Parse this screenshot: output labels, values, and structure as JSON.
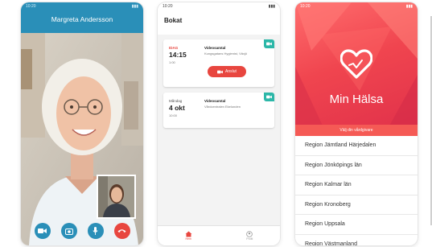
{
  "call": {
    "status_time": "10:20",
    "caller_name": "Margreta Andersson",
    "controls": [
      "camera-icon",
      "switch-camera-icon",
      "microphone-icon",
      "hang-up-icon"
    ]
  },
  "bookings": {
    "status_time": "10:20",
    "title": "Bokat",
    "cards": [
      {
        "day": "IDAG",
        "time": "14:15",
        "duration": "1:00",
        "type": "Videosamtal",
        "place": "Kungsgatans Hygienist, Växjö",
        "join_label": "Anslut"
      },
      {
        "day": "Måndag",
        "time": "4 okt",
        "duration": "10:00",
        "type": "Videosamtal",
        "place": "Vårdcentralen Ekelunden"
      }
    ],
    "nav": [
      {
        "label": "Hem",
        "icon": "home-icon"
      },
      {
        "label": "Profil",
        "icon": "profile-icon"
      }
    ]
  },
  "regions": {
    "status_time": "10:20",
    "app_title": "Min Hälsa",
    "subtitle": "Välj din vårdgivare",
    "items": [
      "Region Jämtland Härjedalen",
      "Region Jönköpings län",
      "Region Kalmar län",
      "Region Kronoberg",
      "Region Uppsala",
      "Region Västmanland"
    ]
  },
  "colors": {
    "call_blue": "#2a8fb8",
    "accent_red": "#e8463f",
    "teal": "#2cb7a8"
  }
}
